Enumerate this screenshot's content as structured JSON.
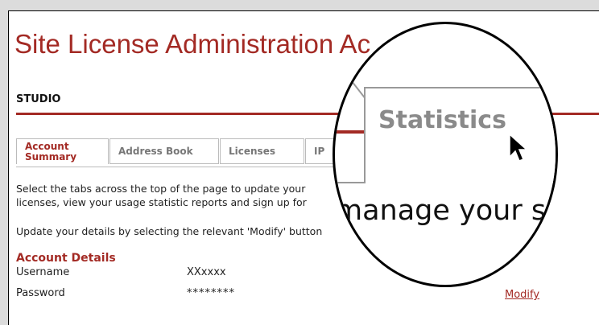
{
  "page": {
    "title": "Site License Administration Ac",
    "organization": "STUDIO"
  },
  "tabs": [
    {
      "label": "Account\nSummary",
      "active": true
    },
    {
      "label": "Address Book",
      "active": false
    },
    {
      "label": "Licenses",
      "active": false
    },
    {
      "label": "IP",
      "active": false
    }
  ],
  "intro": {
    "line1": "Select the tabs across the top of the page to update your",
    "line2": "licenses, view your usage statistic reports and sign up for",
    "line3": "Update your details by selecting the relevant 'Modify' button"
  },
  "account_details": {
    "heading": "Account Details",
    "rows": [
      {
        "label": "Username",
        "value": "XXxxxx"
      },
      {
        "label": "Password",
        "value": "********"
      }
    ],
    "modify_label": "Modify"
  },
  "magnifier": {
    "tab_label": "Statistics",
    "text": "manage your sul"
  },
  "colors": {
    "brand": "#a32a24",
    "tab_border": "#bbbbbb"
  }
}
